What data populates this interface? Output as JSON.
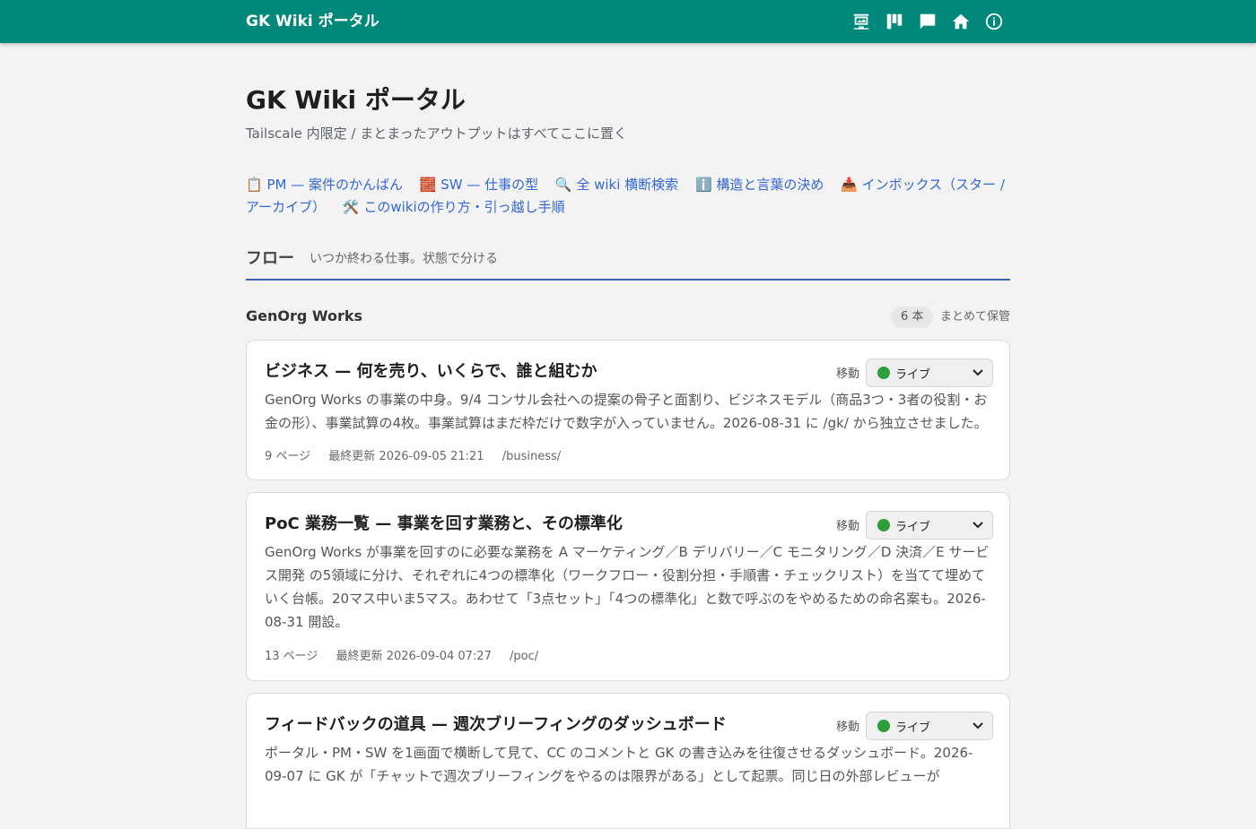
{
  "appbar": {
    "title": "GK Wiki ポータル",
    "icons": [
      {
        "name": "dashboard-icon"
      },
      {
        "name": "kanban-icon"
      },
      {
        "name": "chat-icon"
      },
      {
        "name": "home-icon"
      },
      {
        "name": "info-icon"
      }
    ]
  },
  "page": {
    "title": "GK Wiki ポータル",
    "subtitle": "Tailscale 内限定 / まとまったアウトプットはすべてここに置く"
  },
  "links": [
    {
      "label": "📋 PM — 案件のかんばん"
    },
    {
      "label": "🧱 SW — 仕事の型"
    },
    {
      "label": "🔍 全 wiki 横断検索"
    },
    {
      "label": "ℹ️ 構造と言葉の決め"
    },
    {
      "label": "📥 インボックス（スター / アーカイブ）"
    },
    {
      "label": "🛠️ このwikiの作り方・引っ越し手順"
    }
  ],
  "section": {
    "title": "フロー",
    "description": "いつか終わる仕事。状態で分ける"
  },
  "group": {
    "title": "GenOrg Works",
    "count": "6 本",
    "action": "まとめて保管"
  },
  "cards": [
    {
      "title": "ビジネス — 何を売り、いくらで、誰と組むか",
      "move_label": "移動",
      "status": "ライブ",
      "description": "GenOrg Works の事業の中身。9/4 コンサル会社への提案の骨子と面割り、ビジネスモデル（商品3つ・3者の役割・お金の形）、事業試算の4枚。事業試算はまだ枠だけで数字が入っていません。2026-08-31 に /gk/ から独立させました。",
      "pages": "9 ページ",
      "updated": "最終更新 2026-09-05 21:21",
      "path": "/business/"
    },
    {
      "title": "PoC 業務一覧 — 事業を回す業務と、その標準化",
      "move_label": "移動",
      "status": "ライブ",
      "description": "GenOrg Works が事業を回すのに必要な業務を A マーケティング／B デリバリー／C モニタリング／D 決済／E サービス開発 の5領域に分け、それぞれに4つの標準化（ワークフロー・役割分担・手順書・チェックリスト）を当てて埋めていく台帳。20マス中いま5マス。あわせて「3点セット」「4つの標準化」と数で呼ぶのをやめるための命名案も。2026-08-31 開設。",
      "pages": "13 ページ",
      "updated": "最終更新 2026-09-04 07:27",
      "path": "/poc/"
    },
    {
      "title": "フィードバックの道具 — 週次ブリーフィングのダッシュボード",
      "move_label": "移動",
      "status": "ライブ",
      "description": "ポータル・PM・SW を1画面で横断して見て、CC のコメントと GK の書き込みを往復させるダッシュボード。2026-09-07 に GK が「チャットで週次ブリーフィングをやるのは限界がある」として起票。同じ日の外部レビューが",
      "pages": "",
      "updated": "",
      "path": ""
    }
  ]
}
